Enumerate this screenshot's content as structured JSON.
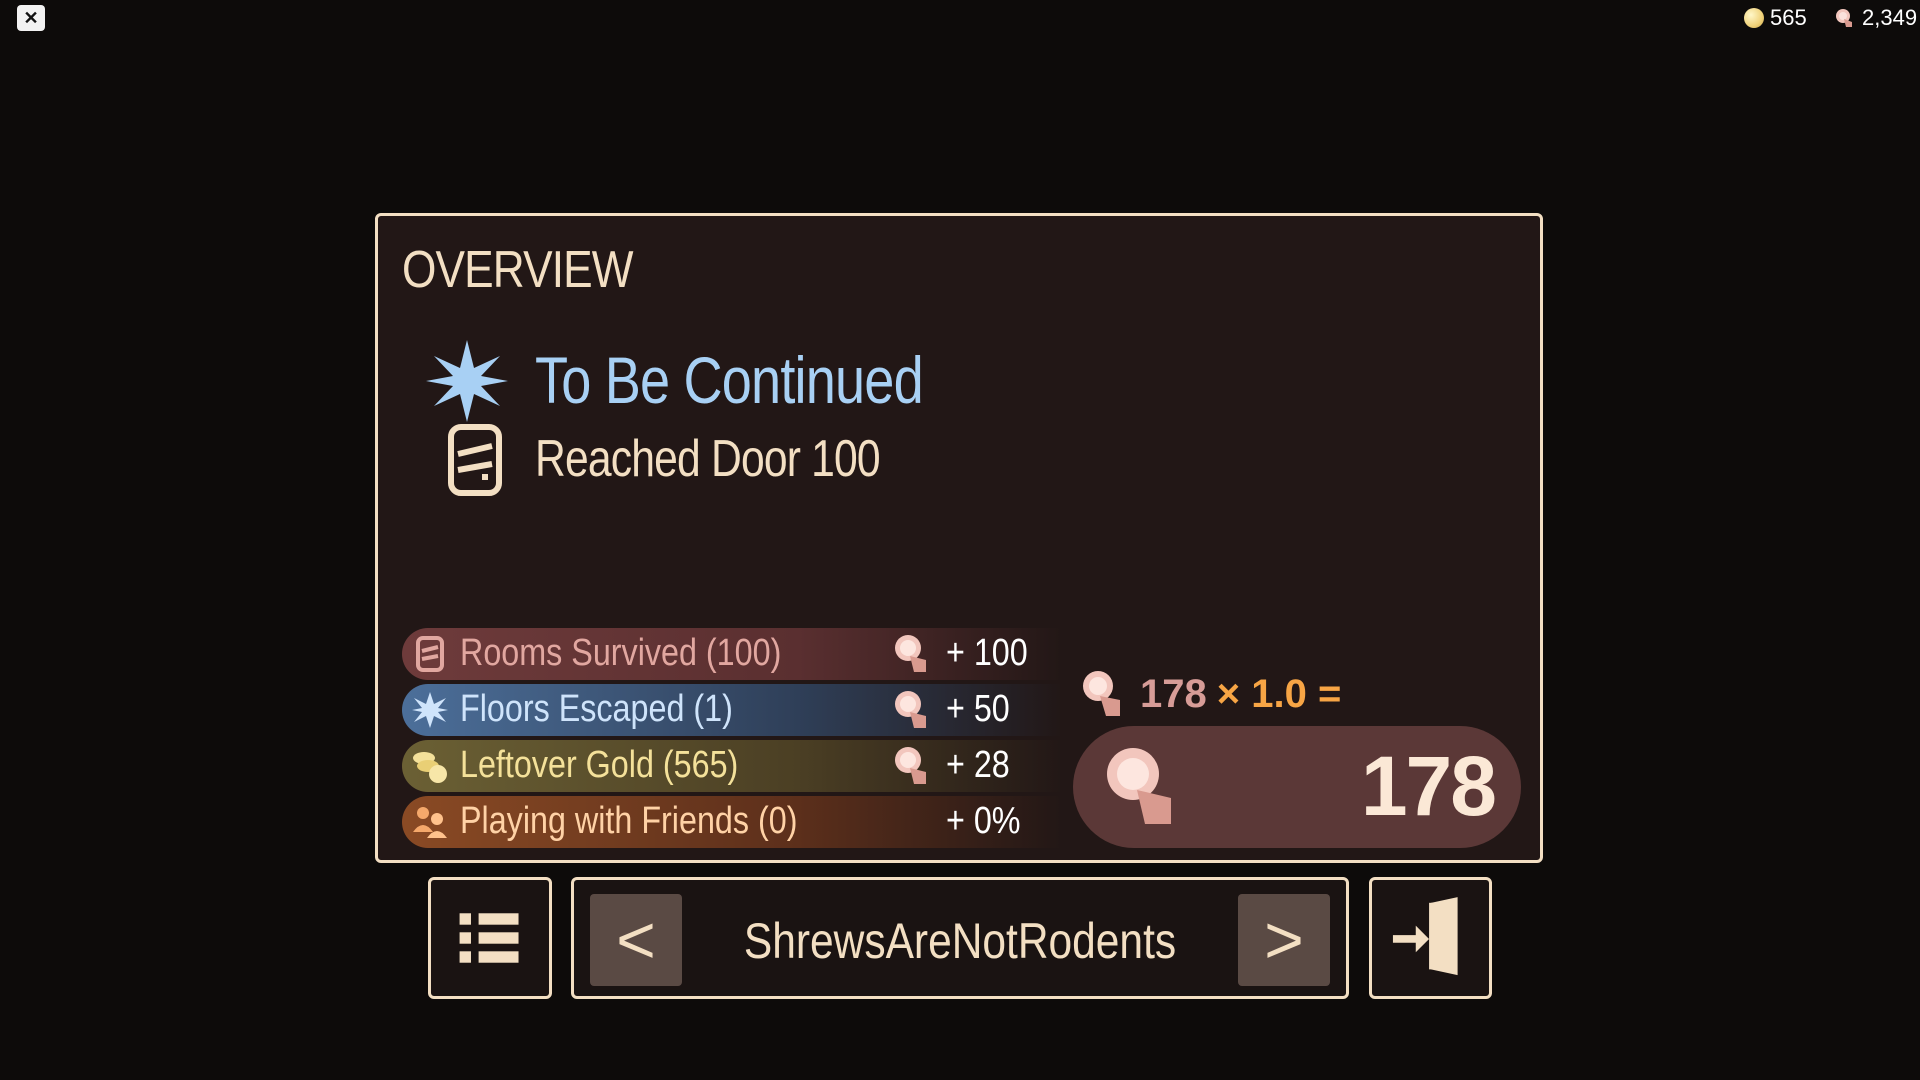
{
  "top_bar": {
    "close_glyph": "✕",
    "gold": "565",
    "knobs": "2,349"
  },
  "overview": {
    "title": "OVERVIEW",
    "achievement_title": "To Be Continued",
    "achievement_subtitle": "Reached Door 100"
  },
  "stats": [
    {
      "label": "Rooms Survived (100)",
      "value": "+ 100",
      "icon": "door-icon",
      "color": "#e1a7a0"
    },
    {
      "label": "Floors Escaped (1)",
      "value": "+ 50",
      "icon": "star-icon",
      "color": "#cfe4fb"
    },
    {
      "label": "Leftover Gold (565)",
      "value": "+ 28",
      "icon": "gold-pile-icon",
      "color": "#f4e19a"
    },
    {
      "label": "Playing with Friends (0)",
      "value": "+ 0%",
      "icon": "friends-icon",
      "color": "#ffd2a6"
    }
  ],
  "formula": {
    "base": "178",
    "multiplier": "× 1.0 ="
  },
  "total": "178",
  "nav": {
    "prev_label": "<",
    "next_label": ">",
    "player_name": "ShrewsAreNotRodents"
  },
  "colors": {
    "panel_bg": "#221716",
    "accent": "#f3dfc3",
    "achievement_blue": "#a8d0f4",
    "multiplier_orange": "#f7a545"
  }
}
